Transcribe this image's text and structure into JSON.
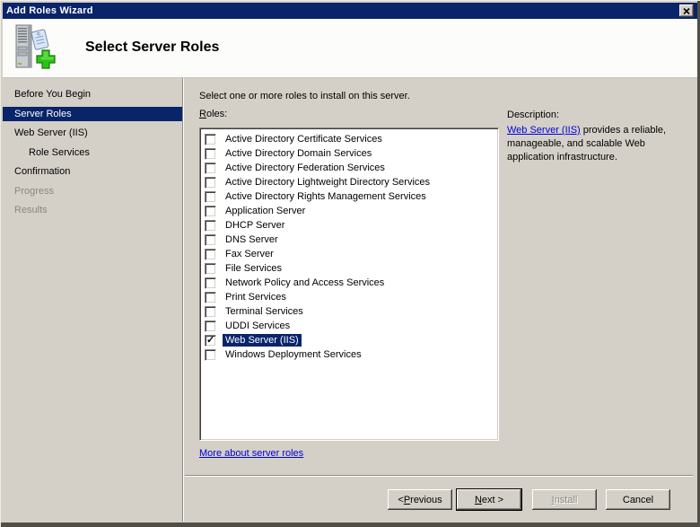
{
  "window": {
    "title": "Add Roles Wizard"
  },
  "header": {
    "title": "Select Server Roles"
  },
  "sidebar": {
    "items": [
      {
        "label": "Before You Begin"
      },
      {
        "label": "Server Roles",
        "active": true
      },
      {
        "label": "Web Server (IIS)"
      },
      {
        "label": "Role Services",
        "indented": true
      },
      {
        "label": "Confirmation"
      },
      {
        "label": "Progress",
        "disabled": true
      },
      {
        "label": "Results",
        "disabled": true
      }
    ]
  },
  "main": {
    "instruction": "Select one or more roles to install on this server.",
    "roles_label": {
      "label": "Roles:",
      "mnemonic": "R"
    },
    "roles": [
      {
        "name": "Active Directory Certificate Services"
      },
      {
        "name": "Active Directory Domain Services"
      },
      {
        "name": "Active Directory Federation Services"
      },
      {
        "name": "Active Directory Lightweight Directory Services"
      },
      {
        "name": "Active Directory Rights Management Services"
      },
      {
        "name": "Application Server"
      },
      {
        "name": "DHCP Server"
      },
      {
        "name": "DNS Server"
      },
      {
        "name": "Fax Server"
      },
      {
        "name": "File Services"
      },
      {
        "name": "Network Policy and Access Services"
      },
      {
        "name": "Print Services"
      },
      {
        "name": "Terminal Services"
      },
      {
        "name": "UDDI Services"
      },
      {
        "name": "Web Server (IIS)",
        "checked": true,
        "selected": true
      },
      {
        "name": "Windows Deployment Services"
      }
    ],
    "more_link": "More about server roles"
  },
  "description": {
    "heading": "Description:",
    "link_text": "Web Server (IIS)",
    "body_text": "provides a reliable, manageable, and scalable Web application infrastructure."
  },
  "footer": {
    "previous": {
      "label": "< Previous",
      "mnemonic": "P"
    },
    "next": {
      "label": "Next >",
      "mnemonic": "N"
    },
    "install": {
      "label": "Install",
      "mnemonic": "I"
    },
    "cancel": {
      "label": "Cancel",
      "mnemonic": ""
    }
  },
  "colors": {
    "titlebar": "#0a246a",
    "selection": "#0a246a",
    "dialog_bg": "#d4d0c8",
    "link": "#0000dd"
  }
}
